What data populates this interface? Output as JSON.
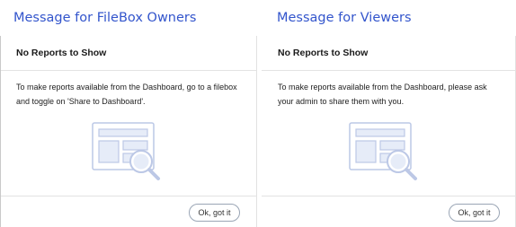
{
  "owners_panel": {
    "caption": "Message for FileBox Owners",
    "card": {
      "title": "No Reports to Show",
      "message": "To make reports available from the Dashboard, go to a filebox and toggle on 'Share to Dashboard'.",
      "illustration_icon": "dashboard-search-illustration",
      "ok_label": "Ok, got it"
    }
  },
  "viewers_panel": {
    "caption": "Message for Viewers",
    "card": {
      "title": "No Reports to Show",
      "message": "To make reports available from the Dashboard, please ask your admin to share them with you.",
      "illustration_icon": "dashboard-search-illustration",
      "ok_label": "Ok, got it"
    }
  },
  "colors": {
    "caption": "#3355cc",
    "illustration_stroke": "#bcc8e6",
    "illustration_fill": "#e6ecf8"
  }
}
